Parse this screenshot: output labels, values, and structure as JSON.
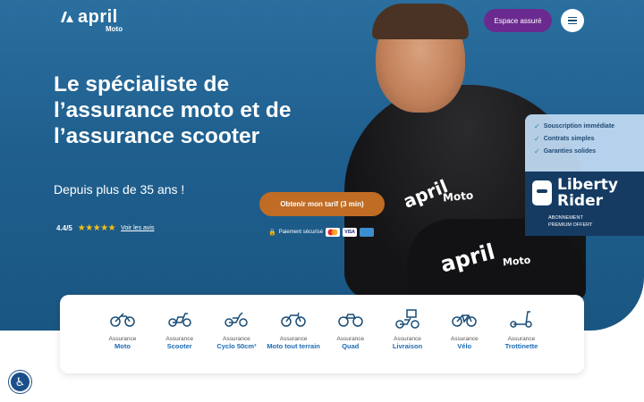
{
  "brand": {
    "name": "april",
    "sub": "Moto"
  },
  "header": {
    "espace_label": "Espace assuré",
    "menu_icon": "hamburger-icon"
  },
  "hero": {
    "title": "Le spécialiste de l’assurance moto et de l’assurance scooter",
    "subtitle": "Depuis plus de 35 ans !",
    "rating_score": "4.4/5",
    "rating_stars": "★★★★★",
    "rating_link": "Voir les avis",
    "cta": "Obtenir mon tarif (3 min)",
    "secure": "Paiement sécurisé",
    "suit_logo": "april",
    "suit_sub": "Moto"
  },
  "benefits": [
    "Souscription immédiate",
    "Contrats simples",
    "Garanties solides"
  ],
  "liberty": {
    "name_line1": "Liberty",
    "name_line2": "Rider",
    "sub_line1": "ABONNEMENT",
    "sub_line2": "PREMIUM OFFERT"
  },
  "categories": [
    {
      "top": "Assurance",
      "name": "Moto",
      "icon": "motorcycle-icon"
    },
    {
      "top": "Assurance",
      "name": "Scooter",
      "icon": "scooter-icon"
    },
    {
      "top": "Assurance",
      "name": "Cyclo 50cm³",
      "icon": "moped-icon"
    },
    {
      "top": "Assurance",
      "name": "Moto tout terrain",
      "icon": "dirtbike-icon"
    },
    {
      "top": "Assurance",
      "name": "Quad",
      "icon": "quad-icon"
    },
    {
      "top": "Assurance",
      "name": "Livraison",
      "icon": "delivery-icon"
    },
    {
      "top": "Assurance",
      "name": "Vélo",
      "icon": "bicycle-icon"
    },
    {
      "top": "Assurance",
      "name": "Trottinette",
      "icon": "scooter-kick-icon"
    }
  ],
  "accessibility_icon": "accessibility-icon",
  "colors": {
    "hero": "#1f5f8e",
    "espace": "#6b2a8f",
    "cta": "#c06c24",
    "link": "#1e6bb5"
  }
}
